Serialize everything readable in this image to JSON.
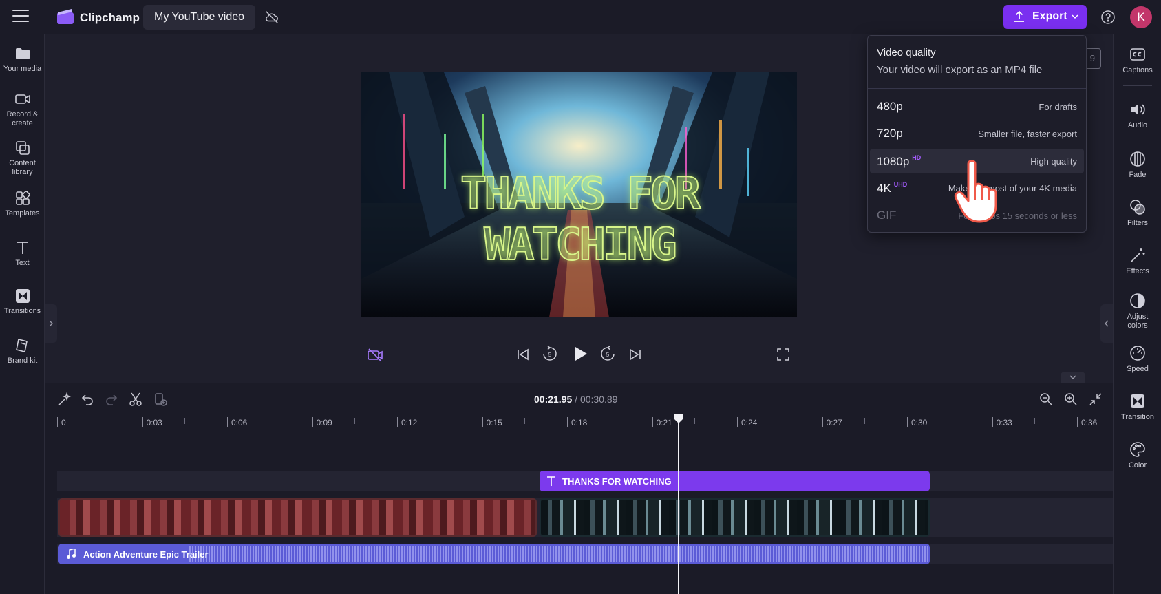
{
  "header": {
    "app_name": "Clipchamp",
    "project_title": "My YouTube video",
    "export_label": "Export",
    "avatar_initial": "K",
    "accent_color": "#7a2ff0"
  },
  "left_sidebar": {
    "items": [
      {
        "label": "Your media",
        "icon": "folder-icon"
      },
      {
        "label": "Record & create",
        "icon": "camera-icon"
      },
      {
        "label": "Content library",
        "icon": "content-library-icon"
      },
      {
        "label": "Templates",
        "icon": "templates-icon"
      },
      {
        "label": "Text",
        "icon": "text-icon"
      },
      {
        "label": "Transitions",
        "icon": "transitions-icon"
      },
      {
        "label": "Brand kit",
        "icon": "brand-kit-icon"
      }
    ]
  },
  "right_sidebar": {
    "items": [
      {
        "label": "Captions",
        "icon": "captions-icon"
      },
      {
        "label": "Audio",
        "icon": "speaker-icon"
      },
      {
        "label": "Fade",
        "icon": "fade-icon"
      },
      {
        "label": "Filters",
        "icon": "filters-icon"
      },
      {
        "label": "Effects",
        "icon": "magic-wand-icon"
      },
      {
        "label": "Adjust colors",
        "icon": "adjust-colors-icon"
      },
      {
        "label": "Speed",
        "icon": "speedometer-icon"
      },
      {
        "label": "Transition",
        "icon": "transition-icon"
      },
      {
        "label": "Color",
        "icon": "palette-icon"
      }
    ]
  },
  "preview": {
    "overlay_text": "THANKS FOR WATCHING",
    "aspect_ratio_partial": "9"
  },
  "export_menu": {
    "title": "Video quality",
    "subtitle": "Your video will export as an MP4 file",
    "options": [
      {
        "quality": "480p",
        "badge": "",
        "description": "For drafts",
        "state": "normal"
      },
      {
        "quality": "720p",
        "badge": "",
        "description": "Smaller file, faster export",
        "state": "normal"
      },
      {
        "quality": "1080p",
        "badge": "HD",
        "description": "High quality",
        "state": "hover"
      },
      {
        "quality": "4K",
        "badge": "UHD",
        "description": "Make the most of your 4K media",
        "state": "normal"
      },
      {
        "quality": "GIF",
        "badge": "",
        "description": "For videos 15 seconds or less",
        "state": "disabled"
      }
    ]
  },
  "timeline": {
    "current_time": "00:21.95",
    "separator": " / ",
    "total_time": "00:30.89",
    "ruler_labels": [
      "0",
      "0:03",
      "0:06",
      "0:09",
      "0:12",
      "0:15",
      "0:18",
      "0:21",
      "0:24",
      "0:27",
      "0:30",
      "0:33",
      "0:36"
    ],
    "text_clip_label": "THANKS FOR WATCHING",
    "audio_clip_label": "Action Adventure Epic Trailer",
    "playhead_seconds": 21.95
  }
}
